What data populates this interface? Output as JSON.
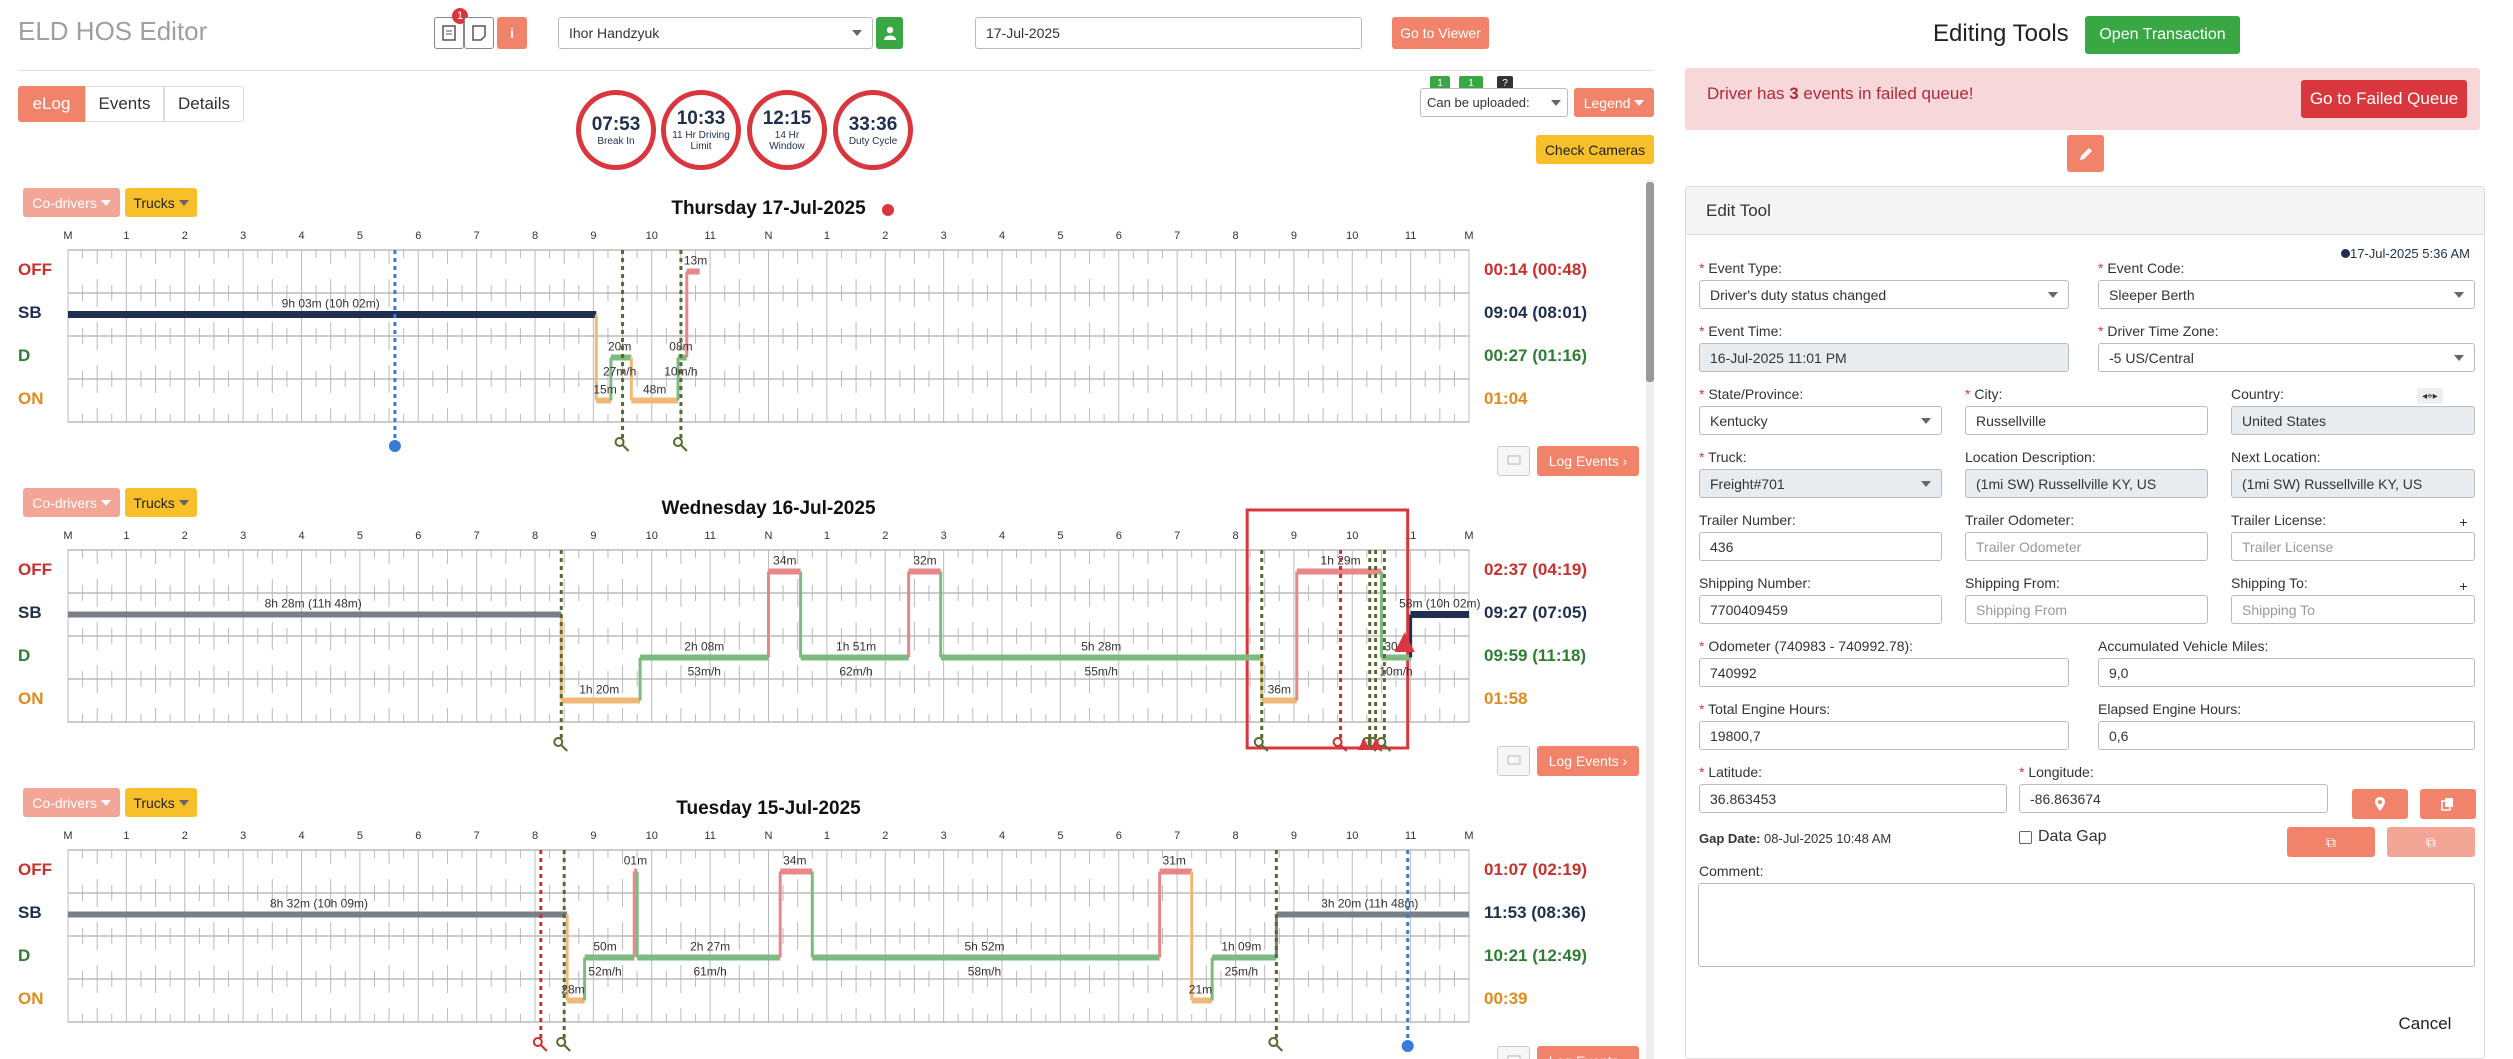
{
  "app": {
    "title": "ELD HOS Editor",
    "notif_count": "1",
    "driver_name": "Ihor Handzyuk",
    "date": "17-Jul-2025",
    "go_to_viewer": "Go to Viewer"
  },
  "tabs": [
    {
      "label": "eLog"
    },
    {
      "label": "Events"
    },
    {
      "label": "Details"
    }
  ],
  "gauges": [
    {
      "value": "07:53",
      "label": "Break In"
    },
    {
      "value": "10:33",
      "label": "11 Hr Driving Limit"
    },
    {
      "value": "12:15",
      "label": "14 Hr Window"
    },
    {
      "value": "33:36",
      "label": "Duty Cycle"
    }
  ],
  "upload": {
    "badge_a": "1",
    "badge_b": "1",
    "badge_q": "?",
    "select_label": "Can be uploaded:",
    "legend": "Legend",
    "check_cameras": "Check Cameras"
  },
  "common": {
    "co_drivers": "Co-drivers",
    "trucks": "Trucks",
    "log_events": "Log Events"
  },
  "status_labels": [
    "OFF",
    "SB",
    "D",
    "ON"
  ],
  "hours": [
    "M",
    "1",
    "2",
    "3",
    "4",
    "5",
    "6",
    "7",
    "8",
    "9",
    "10",
    "11",
    "N",
    "1",
    "2",
    "3",
    "4",
    "5",
    "6",
    "7",
    "8",
    "9",
    "10",
    "11",
    "M"
  ],
  "colors": {
    "off": "#e8868a",
    "sb": "#1f2f4f",
    "d": "#7dba7f",
    "on": "#f0b878",
    "accent": "#f0836a",
    "danger": "#d9363e",
    "success": "#3aa745"
  },
  "days": [
    {
      "title": "Thursday 17-Jul-2025",
      "totals": [
        "00:14 (00:48)",
        "09:04 (08:01)",
        "00:27 (01:16)",
        "01:04"
      ],
      "segments": [
        {
          "row": 1,
          "s": 0,
          "e": 9.05,
          "color": "sb"
        },
        {
          "row": 3,
          "s": 9.05,
          "e": 9.3,
          "color": "on"
        },
        {
          "row": 2,
          "s": 9.3,
          "e": 9.65,
          "color": "d"
        },
        {
          "row": 3,
          "s": 9.65,
          "e": 10.45,
          "color": "on"
        },
        {
          "row": 2,
          "s": 10.45,
          "e": 10.6,
          "color": "d"
        },
        {
          "row": 0,
          "s": 10.6,
          "e": 10.82,
          "color": "off"
        }
      ],
      "labels": [
        {
          "row": 1,
          "h": 4.5,
          "t": "9h 03m (10h 02m)"
        },
        {
          "row": 2,
          "h": 9.45,
          "t": "20m",
          "up": true
        },
        {
          "row": 2,
          "h": 9.45,
          "t": "27m/h",
          "dn": true
        },
        {
          "row": 3,
          "h": 9.2,
          "t": "15m",
          "up": true
        },
        {
          "row": 3,
          "h": 10.05,
          "t": "48m",
          "up": true
        },
        {
          "row": 2,
          "h": 10.5,
          "t": "08m",
          "up": true
        },
        {
          "row": 2,
          "h": 10.5,
          "t": "10m/h",
          "dn": true
        },
        {
          "row": 0,
          "h": 10.75,
          "t": "13m",
          "up": true
        }
      ],
      "markers": [
        {
          "h": 5.6,
          "color": "#3a7bd5",
          "type": "dot"
        },
        {
          "h": 9.5,
          "color": "#556b2f",
          "type": "key"
        },
        {
          "h": 10.5,
          "color": "#556b2f",
          "type": "key"
        }
      ],
      "title_dot": true
    },
    {
      "title": "Wednesday 16-Jul-2025",
      "totals": [
        "02:37 (04:19)",
        "09:27 (07:05)",
        "09:59 (11:18)",
        "01:58"
      ],
      "segments": [
        {
          "row": 1,
          "s": 0,
          "e": 8.45,
          "color": "sb_grey"
        },
        {
          "row": 3,
          "s": 8.45,
          "e": 9.8,
          "color": "on"
        },
        {
          "row": 2,
          "s": 9.8,
          "e": 12,
          "color": "d"
        },
        {
          "row": 0,
          "s": 12,
          "e": 12.55,
          "color": "off"
        },
        {
          "row": 2,
          "s": 12.55,
          "e": 14.4,
          "color": "d"
        },
        {
          "row": 0,
          "s": 14.4,
          "e": 14.95,
          "color": "off"
        },
        {
          "row": 2,
          "s": 14.95,
          "e": 20.45,
          "color": "d"
        },
        {
          "row": 3,
          "s": 20.45,
          "e": 21.05,
          "color": "on"
        },
        {
          "row": 0,
          "s": 21.05,
          "e": 22.5,
          "color": "off"
        },
        {
          "row": 2,
          "s": 22.5,
          "e": 23,
          "color": "d"
        },
        {
          "row": 1,
          "s": 23,
          "e": 24,
          "color": "sb"
        }
      ],
      "labels": [
        {
          "row": 1,
          "h": 4.2,
          "t": "8h 28m (11h 48m)"
        },
        {
          "row": 3,
          "h": 9.1,
          "t": "1h 20m",
          "up": true
        },
        {
          "row": 2,
          "h": 10.9,
          "t": "2h 08m",
          "up": true
        },
        {
          "row": 2,
          "h": 10.9,
          "t": "53m/h",
          "dn": true
        },
        {
          "row": 0,
          "h": 12.28,
          "t": "34m",
          "up": true
        },
        {
          "row": 2,
          "h": 13.5,
          "t": "1h 51m",
          "up": true
        },
        {
          "row": 2,
          "h": 13.5,
          "t": "62m/h",
          "dn": true
        },
        {
          "row": 0,
          "h": 14.68,
          "t": "32m",
          "up": true
        },
        {
          "row": 2,
          "h": 17.7,
          "t": "5h 28m",
          "up": true
        },
        {
          "row": 2,
          "h": 17.7,
          "t": "55m/h",
          "dn": true
        },
        {
          "row": 3,
          "h": 20.75,
          "t": "36m",
          "up": true
        },
        {
          "row": 0,
          "h": 21.8,
          "t": "1h 29m",
          "up": true
        },
        {
          "row": 2,
          "h": 22.75,
          "t": "30m",
          "up": true
        },
        {
          "row": 2,
          "h": 22.75,
          "t": "10m/h",
          "dn": true
        },
        {
          "row": 1,
          "h": 23.5,
          "t": "58m (10h 02m)",
          "up": true
        }
      ],
      "markers": [
        {
          "h": 8.45,
          "color": "#556b2f",
          "type": "key"
        },
        {
          "h": 20.45,
          "color": "#556b2f",
          "type": "key"
        },
        {
          "h": 21.8,
          "color": "#c9302c",
          "type": "key"
        },
        {
          "h": 22.3,
          "color": "#556b2f",
          "type": "key"
        },
        {
          "h": 22.4,
          "color": "#556b2f",
          "type": "key"
        },
        {
          "h": 22.55,
          "color": "#556b2f",
          "type": "key"
        }
      ],
      "highlight": {
        "s": 20.2,
        "e": 22.95
      }
    },
    {
      "title": "Tuesday 15-Jul-2025",
      "totals": [
        "01:07 (02:19)",
        "11:53 (08:36)",
        "10:21 (12:49)",
        "00:39"
      ],
      "segments": [
        {
          "row": 1,
          "s": 0,
          "e": 8.55,
          "color": "sb_grey"
        },
        {
          "row": 3,
          "s": 8.55,
          "e": 8.85,
          "color": "on"
        },
        {
          "row": 2,
          "s": 8.85,
          "e": 9.7,
          "color": "d"
        },
        {
          "row": 0,
          "s": 9.7,
          "e": 9.75,
          "color": "off"
        },
        {
          "row": 2,
          "s": 9.75,
          "e": 12.2,
          "color": "d"
        },
        {
          "row": 0,
          "s": 12.2,
          "e": 12.75,
          "color": "off"
        },
        {
          "row": 2,
          "s": 12.75,
          "e": 18.7,
          "color": "d"
        },
        {
          "row": 0,
          "s": 18.7,
          "e": 19.25,
          "color": "off"
        },
        {
          "row": 3,
          "s": 19.25,
          "e": 19.6,
          "color": "on"
        },
        {
          "row": 2,
          "s": 19.6,
          "e": 20.7,
          "color": "d"
        },
        {
          "row": 1,
          "s": 20.7,
          "e": 24,
          "color": "sb_grey"
        }
      ],
      "labels": [
        {
          "row": 1,
          "h": 4.3,
          "t": "8h 32m (10h 09m)"
        },
        {
          "row": 3,
          "h": 8.65,
          "t": "28m",
          "up": true
        },
        {
          "row": 2,
          "h": 9.2,
          "t": "50m",
          "up": true
        },
        {
          "row": 2,
          "h": 9.2,
          "t": "52m/h",
          "dn": true
        },
        {
          "row": 0,
          "h": 9.72,
          "t": "01m",
          "up": true
        },
        {
          "row": 2,
          "h": 11.0,
          "t": "2h 27m",
          "up": true
        },
        {
          "row": 2,
          "h": 11.0,
          "t": "61m/h",
          "dn": true
        },
        {
          "row": 0,
          "h": 12.45,
          "t": "34m",
          "up": true
        },
        {
          "row": 2,
          "h": 15.7,
          "t": "5h 52m",
          "up": true
        },
        {
          "row": 2,
          "h": 15.7,
          "t": "58m/h",
          "dn": true
        },
        {
          "row": 0,
          "h": 18.95,
          "t": "31m",
          "up": true
        },
        {
          "row": 3,
          "h": 19.4,
          "t": "21m",
          "up": true
        },
        {
          "row": 2,
          "h": 20.1,
          "t": "1h 09m",
          "up": true
        },
        {
          "row": 2,
          "h": 20.1,
          "t": "25m/h",
          "dn": true
        },
        {
          "row": 1,
          "h": 22.3,
          "t": "3h 20m (11h 48m)",
          "up": true
        }
      ],
      "markers": [
        {
          "h": 8.1,
          "color": "#c9302c",
          "type": "key"
        },
        {
          "h": 8.5,
          "color": "#556b2f",
          "type": "key"
        },
        {
          "h": 20.7,
          "color": "#556b2f",
          "type": "key"
        },
        {
          "h": 22.95,
          "color": "#3a7bd5",
          "type": "dot"
        }
      ]
    }
  ],
  "right": {
    "title": "Editing Tools",
    "open_transaction": "Open Transaction",
    "alert_pre": "Driver has ",
    "alert_count": "3",
    "alert_post": " events in failed queue!",
    "go_failed": "Go to Failed Queue",
    "edit_tool": "Edit Tool",
    "event_date": "17-Jul-2025 5:36 AM",
    "fields": {
      "event_type": {
        "label": "Event Type:",
        "value": "Driver's duty status changed"
      },
      "event_code": {
        "label": "Event Code:",
        "value": "Sleeper Berth"
      },
      "event_time": {
        "label": "Event Time:",
        "value": "16-Jul-2025 11:01 PM"
      },
      "driver_tz": {
        "label": "Driver Time Zone:",
        "value": "-5 US/Central"
      },
      "state": {
        "label": "State/Province:",
        "value": "Kentucky"
      },
      "city": {
        "label": "City:",
        "value": "Russellville"
      },
      "country": {
        "label": "Country:",
        "value": "United States"
      },
      "truck": {
        "label": "Truck:",
        "value": "Freight#701"
      },
      "loc_desc": {
        "label": "Location Description:",
        "value": "(1mi SW) Russellville KY, US"
      },
      "next_loc": {
        "label": "Next Location:",
        "value": "(1mi SW) Russellville KY, US"
      },
      "trailer_num": {
        "label": "Trailer Number:",
        "value": "436"
      },
      "trailer_odo": {
        "label": "Trailer Odometer:",
        "placeholder": "Trailer Odometer"
      },
      "trailer_lic": {
        "label": "Trailer License:",
        "placeholder": "Trailer License"
      },
      "ship_num": {
        "label": "Shipping Number:",
        "value": "7700409459"
      },
      "ship_from": {
        "label": "Shipping From:",
        "placeholder": "Shipping From"
      },
      "ship_to": {
        "label": "Shipping To:",
        "placeholder": "Shipping To"
      },
      "odometer": {
        "label": "Odometer (740983 - 740992.78):",
        "value": "740992"
      },
      "acc_miles": {
        "label": "Accumulated Vehicle Miles:",
        "value": "9,0"
      },
      "eng_hours": {
        "label": "Total Engine Hours:",
        "value": "19800,7"
      },
      "elapsed_hours": {
        "label": "Elapsed Engine Hours:",
        "value": "0,6"
      },
      "lat": {
        "label": "Latitude:",
        "value": "36.863453"
      },
      "lon": {
        "label": "Longitude:",
        "value": "-86.863674"
      }
    },
    "gap_label": "Gap Date:",
    "gap_value": "08-Jul-2025 10:48 AM",
    "data_gap": "Data Gap",
    "comment": "Comment:",
    "cancel": "Cancel"
  }
}
